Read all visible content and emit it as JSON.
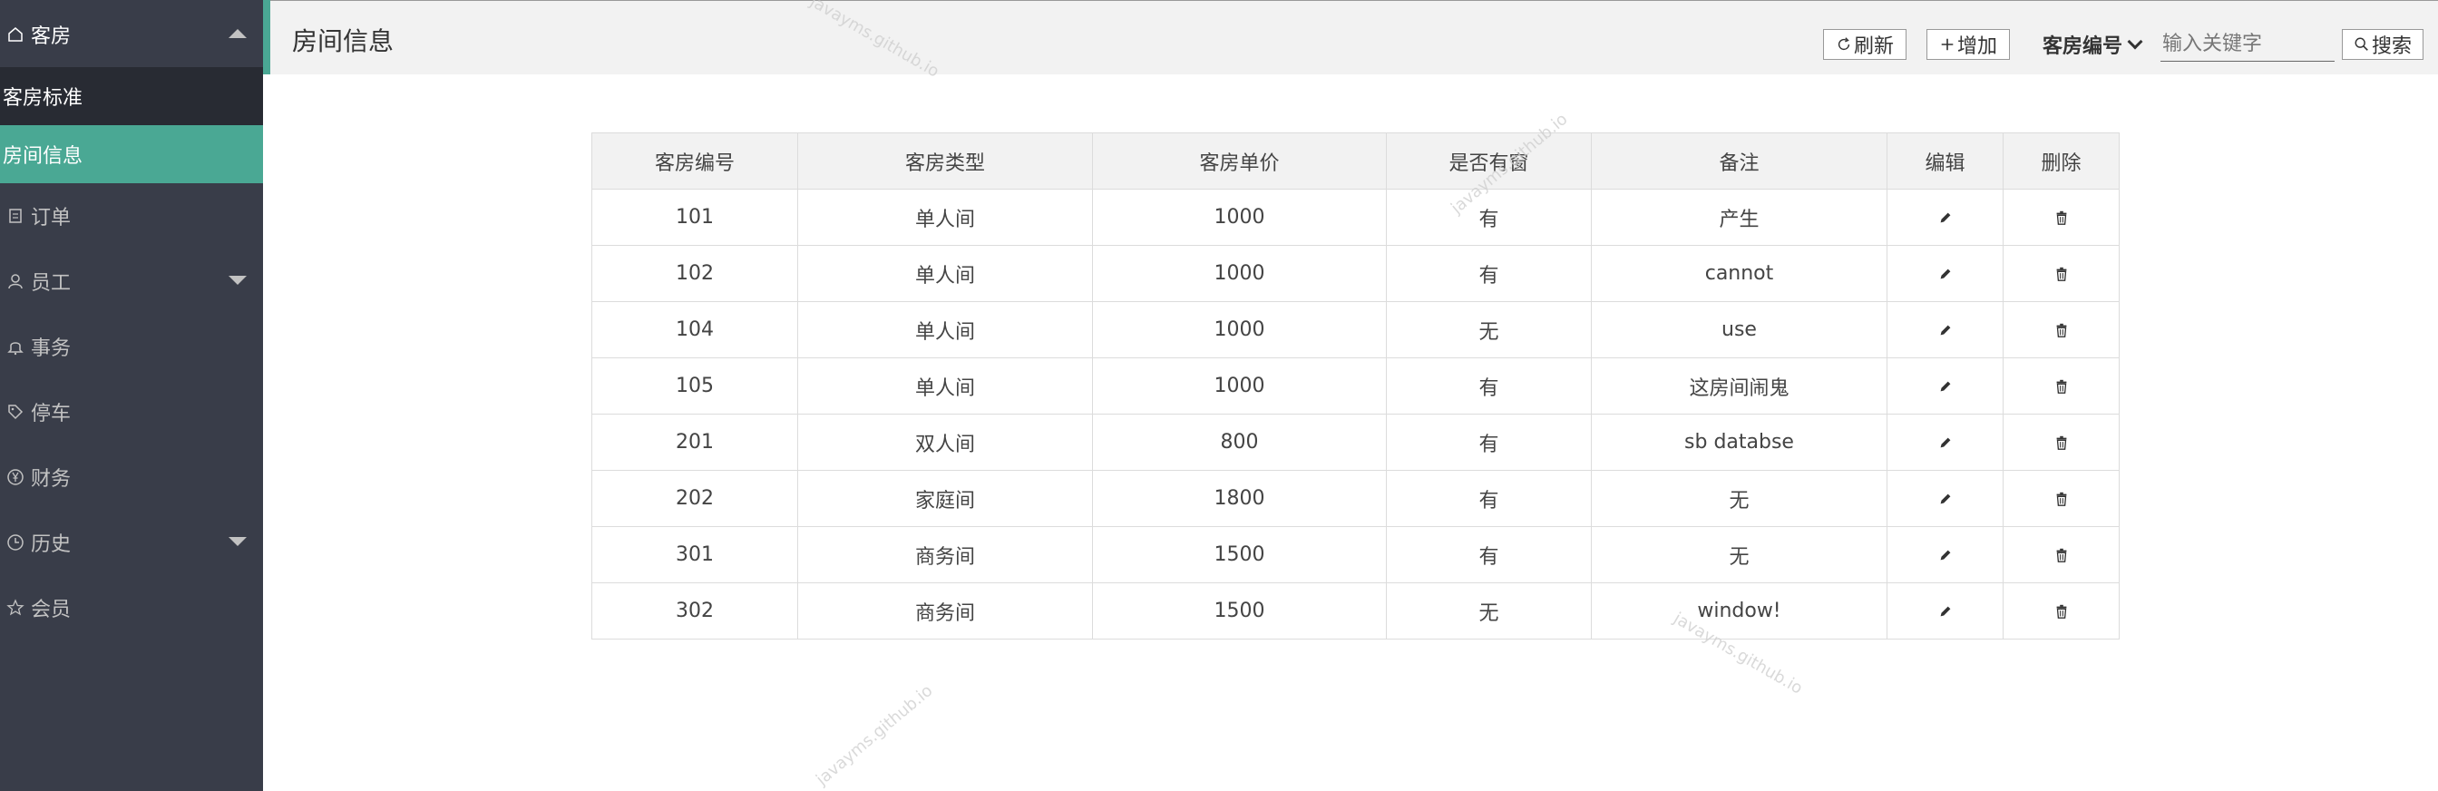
{
  "sidebar": {
    "menu": [
      {
        "label": "客房",
        "icon": "home-icon"
      },
      {
        "label": "订单",
        "icon": "order-icon"
      },
      {
        "label": "员工",
        "icon": "user-icon"
      },
      {
        "label": "事务",
        "icon": "bell-icon"
      },
      {
        "label": "停车",
        "icon": "tag-icon"
      },
      {
        "label": "财务",
        "icon": "yen-icon"
      },
      {
        "label": "历史",
        "icon": "clock-icon"
      },
      {
        "label": "会员",
        "icon": "star-icon"
      }
    ],
    "submenu": [
      {
        "label": "客房标准"
      },
      {
        "label": "房间信息"
      }
    ]
  },
  "header": {
    "title": "房间信息",
    "refresh_label": "刷新",
    "add_label": "增加",
    "search_field_label": "客房编号",
    "search_placeholder": "输入关键字",
    "search_button_label": "搜索"
  },
  "table": {
    "columns": [
      "客房编号",
      "客房类型",
      "客房单价",
      "是否有窗",
      "备注",
      "编辑",
      "删除"
    ],
    "rows": [
      {
        "id": "101",
        "type": "单人间",
        "price": "1000",
        "window": "有",
        "note": "产生"
      },
      {
        "id": "102",
        "type": "单人间",
        "price": "1000",
        "window": "有",
        "note": "cannot"
      },
      {
        "id": "104",
        "type": "单人间",
        "price": "1000",
        "window": "无",
        "note": "use"
      },
      {
        "id": "105",
        "type": "单人间",
        "price": "1000",
        "window": "有",
        "note": "这房间闹鬼"
      },
      {
        "id": "201",
        "type": "双人间",
        "price": "800",
        "window": "有",
        "note": "sb databse"
      },
      {
        "id": "202",
        "type": "家庭间",
        "price": "1800",
        "window": "有",
        "note": "无"
      },
      {
        "id": "301",
        "type": "商务间",
        "price": "1500",
        "window": "有",
        "note": "无"
      },
      {
        "id": "302",
        "type": "商务间",
        "price": "1500",
        "window": "无",
        "note": "window!"
      }
    ]
  },
  "watermark": "javayms.github.io",
  "colors": {
    "sidebar_bg": "#393d49",
    "accent": "#4aa894",
    "submenu_bg": "#282b33",
    "header_bg": "#f2f2f2"
  }
}
